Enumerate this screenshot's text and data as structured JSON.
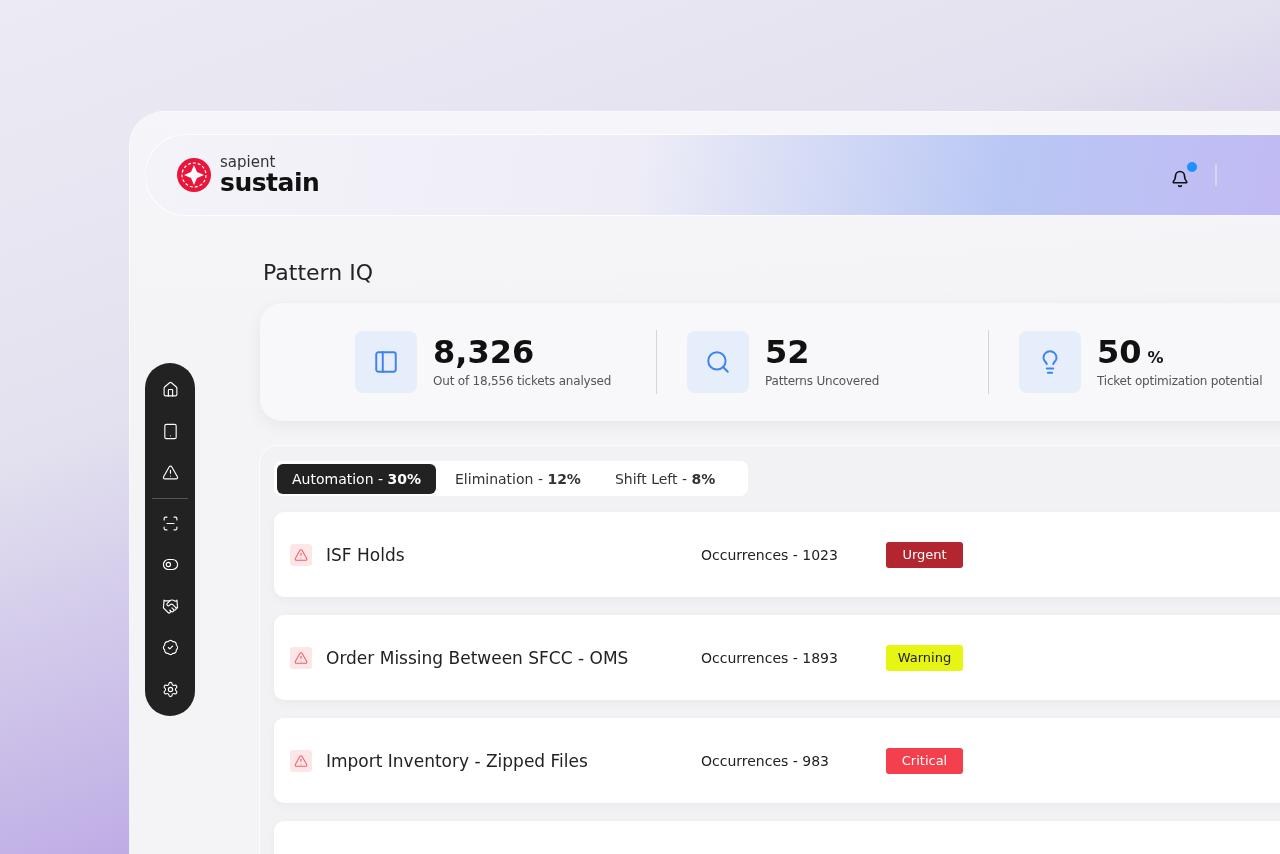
{
  "header": {
    "brand_top": "sapient",
    "brand_name": "sustain",
    "notifications": true
  },
  "page_title": "Pattern IQ",
  "stats": [
    {
      "value": "8,326",
      "label": "Out of 18,556 tickets analysed"
    },
    {
      "value": "52",
      "label": "Patterns Uncovered"
    },
    {
      "value": "50",
      "unit": "%",
      "label": "Ticket optimization potential"
    }
  ],
  "tabs": [
    {
      "label": "Automation - **30%**",
      "selected": true
    },
    {
      "label": "Elimination - **12%**",
      "selected": false
    },
    {
      "label": "Shift Left - **8%**",
      "selected": false
    }
  ],
  "patterns": [
    {
      "title": "ISF Holds",
      "occurrences": "Occurrences - 1023",
      "status": "Urgent",
      "color": "#b3262f"
    },
    {
      "title": "Order Missing Between SFCC - OMS",
      "occurrences": "Occurrences - 1893",
      "status": "Warning",
      "color": "#e6f514"
    },
    {
      "title": "Import Inventory - Zipped Files",
      "occurrences": "Occurrences - 983",
      "status": "Critical",
      "color": "#f43f4c"
    }
  ]
}
